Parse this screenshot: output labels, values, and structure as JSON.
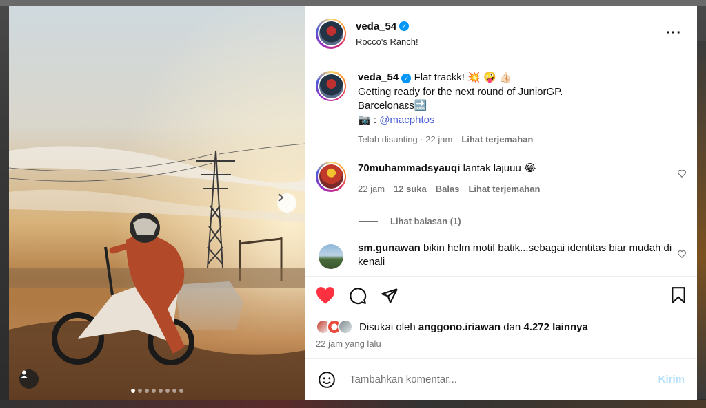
{
  "post": {
    "username": "veda_54",
    "location": "Rocco's Ranch!",
    "caption": {
      "line1": "Flat trackk!",
      "line1_emoji": "💥 🤪 👍🏻",
      "line2": "Getting ready for the next round of JuniorGP.",
      "line3": "Barcelonaɛs",
      "soon_emoji": "🔜",
      "credit_emoji": "📷",
      "credit_sep": ":",
      "credit_mention": "@macphtos"
    },
    "caption_meta": {
      "edited": "Telah disunting · 22 jam",
      "translate": "Lihat terjemahan"
    }
  },
  "comments": [
    {
      "username": "70muhammadsyauqi",
      "text": "lantak lajuuu 😂",
      "time": "22 jam",
      "likes": "12 suka",
      "reply": "Balas",
      "translate": "Lihat terjemahan",
      "view_replies": "Lihat balasan (1)"
    },
    {
      "username": "sm.gunawan",
      "text": "bikin helm motif batik...sebagai identitas biar mudah di kenali"
    }
  ],
  "likes": {
    "prefix": "Disukai oleh",
    "top_liker": "anggono.iriawan",
    "joiner": "dan",
    "others": "4.272 lainnya",
    "time_ago": "22 jam yang lalu"
  },
  "composer": {
    "placeholder": "Tambahkan komentar...",
    "post_label": "Kirim"
  },
  "carousel": {
    "total_slides": 8,
    "current_slide": 1
  },
  "colors": {
    "like_red": "#ff3040",
    "verified_blue": "#0095f6",
    "link_blue": "#4c5fd5",
    "post_disabled": "#b2dffc"
  }
}
